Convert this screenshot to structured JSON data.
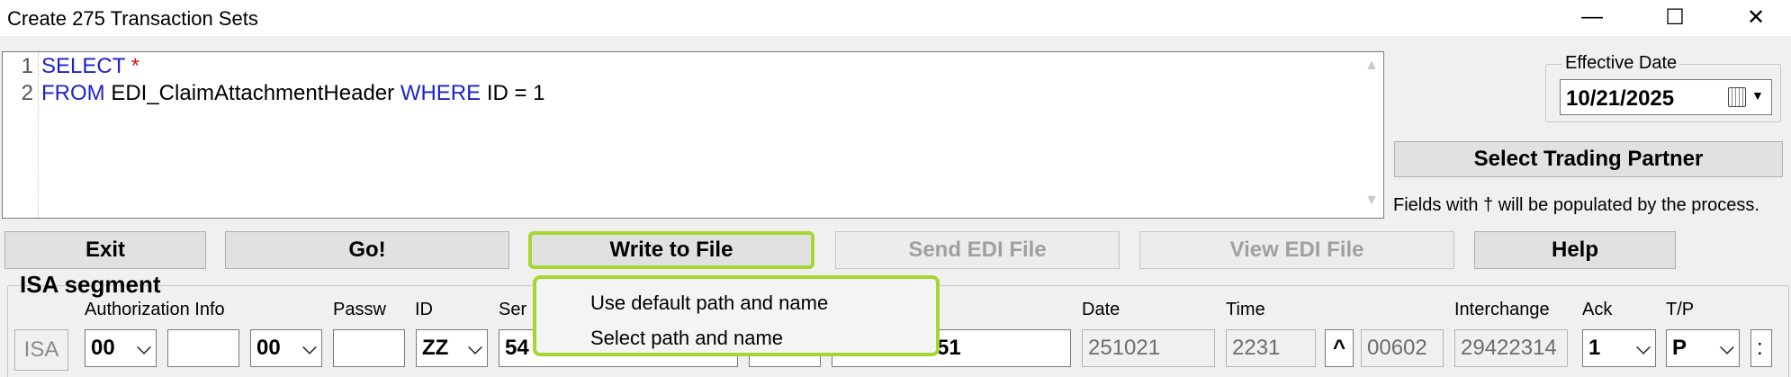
{
  "window": {
    "title": "Create 275 Transaction Sets",
    "minimize": "—",
    "maximize": "☐",
    "close": "✕"
  },
  "editor": {
    "line_numbers": [
      "1",
      "2"
    ],
    "line1": {
      "kw": "SELECT",
      "star": "*"
    },
    "line2": {
      "kw1": "FROM",
      "table": "EDI_ClaimAttachmentHeader",
      "kw2": "WHERE",
      "rest": "ID = 1"
    },
    "scroll_up": "▲",
    "scroll_down": "▼"
  },
  "effective_date": {
    "label": "Effective Date",
    "value": "10/21/2025",
    "dropdown": "▼"
  },
  "trading_partner_button": "Select Trading Partner",
  "note": "Fields with † will be populated by the process.",
  "toolbar": {
    "exit": "Exit",
    "go": "Go!",
    "write_to_file": "Write to File",
    "send_edi": "Send EDI File",
    "view_edi": "View EDI File",
    "help": "Help"
  },
  "context_menu": {
    "items": [
      "Use default path and name",
      "Select path and name"
    ]
  },
  "isa": {
    "section_title": "ISA segment",
    "badge": "ISA",
    "labels": {
      "auth_info": "Authorization Info",
      "passw": "Passw",
      "id": "ID",
      "ser": "Ser",
      "date": "Date",
      "time": "Time",
      "interchange": "Interchange",
      "ack": "Ack",
      "tp": "T/P"
    },
    "values": {
      "auth_qual": "00",
      "auth_info": "",
      "sec_qual": "00",
      "passw": "",
      "id_qual": "ZZ",
      "sender_partial": "54",
      "receiver_partial": "51",
      "date": "251021",
      "time": "2231",
      "rep_sep": "^",
      "version": "00602",
      "control": "29422314",
      "ack": "1",
      "tp": "P",
      "comp_sep": ":"
    }
  }
}
